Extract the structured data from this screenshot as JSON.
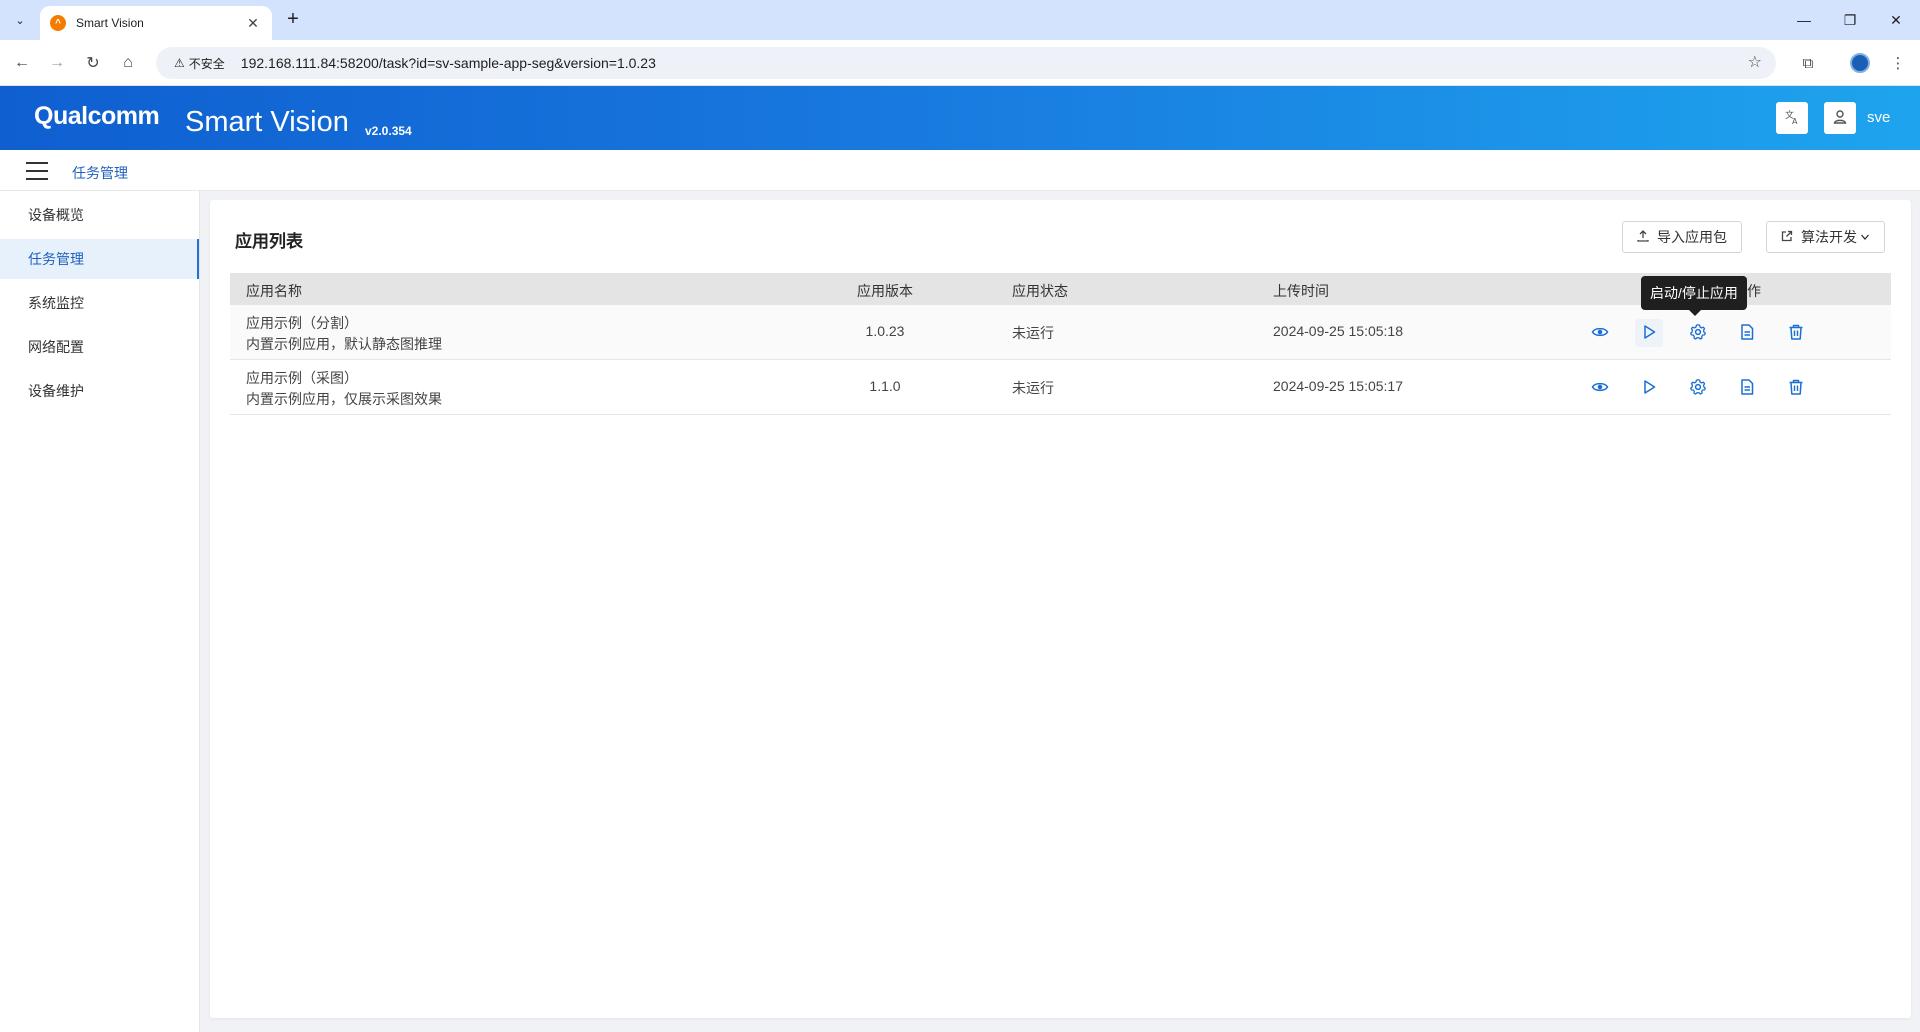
{
  "browser": {
    "tab_title": "Smart Vision",
    "security_label": "不安全",
    "url": "192.168.111.84:58200/task?id=sv-sample-app-seg&version=1.0.23"
  },
  "header": {
    "logo": "Qualcomm",
    "title": "Smart Vision",
    "version": "v2.0.354",
    "username": "sve"
  },
  "breadcrumb": {
    "current": "任务管理"
  },
  "sidebar": {
    "items": [
      {
        "label": "设备概览",
        "active": false
      },
      {
        "label": "任务管理",
        "active": true
      },
      {
        "label": "系统监控",
        "active": false
      },
      {
        "label": "网络配置",
        "active": false
      },
      {
        "label": "设备维护",
        "active": false
      }
    ]
  },
  "main": {
    "title": "应用列表",
    "import_button": "导入应用包",
    "algo_button": "算法开发",
    "table": {
      "headers": [
        "应用名称",
        "应用版本",
        "应用状态",
        "上传时间",
        "作"
      ],
      "rows": [
        {
          "name": "应用示例（分割）",
          "desc": "内置示例应用，默认静态图推理",
          "version": "1.0.23",
          "status": "未运行",
          "time": "2024-09-25 15:05:18"
        },
        {
          "name": "应用示例（采图）",
          "desc": "内置示例应用，仅展示采图效果",
          "version": "1.1.0",
          "status": "未运行",
          "time": "2024-09-25 15:05:17"
        }
      ]
    },
    "tooltip": "启动/停止应用"
  },
  "colors": {
    "accent": "#1f6fd6",
    "header_start": "#0f5fd0",
    "header_end": "#1ea4ee",
    "icon_blue": "#1a6fd4"
  },
  "icons": [
    "eye-icon",
    "play-icon",
    "gear-icon",
    "document-icon",
    "trash-icon"
  ]
}
